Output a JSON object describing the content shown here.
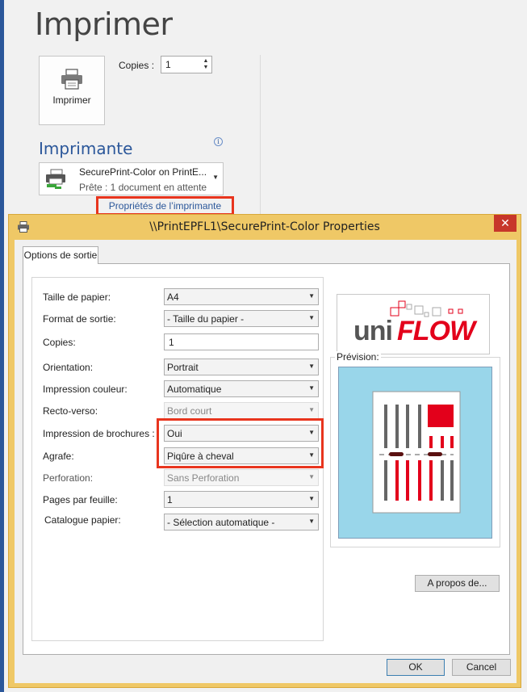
{
  "backstage": {
    "title": "Imprimer",
    "print_button_label": "Imprimer",
    "copies_label": "Copies :",
    "copies_value": "1",
    "printer_heading": "Imprimante",
    "info_icon": "i",
    "printer_name": "SecurePrint-Color on PrintE...",
    "printer_status": "Prête : 1 document en attente",
    "properties_link": "Propriétés de l’imprimante"
  },
  "dialog": {
    "title": "\\\\PrintEPFL1\\SecurePrint-Color Properties",
    "close_glyph": "✕",
    "tab_label": "Options de sortie",
    "fields": [
      {
        "label": "Taille de papier:",
        "value": "A4",
        "type": "combo",
        "enabled": true
      },
      {
        "label": "Format de sortie:",
        "value": "- Taille du papier -",
        "type": "combo",
        "enabled": true
      },
      {
        "label": "Copies:",
        "value": "1",
        "type": "text",
        "enabled": true
      },
      {
        "label": "Orientation:",
        "value": "Portrait",
        "type": "combo",
        "enabled": true
      },
      {
        "label": "Impression couleur:",
        "value": "Automatique",
        "type": "combo",
        "enabled": true
      },
      {
        "label": "Recto-verso:",
        "value": "Bord court",
        "type": "combo",
        "enabled": false
      },
      {
        "label": "Impression de brochures :",
        "value": "Oui",
        "type": "combo",
        "enabled": true
      },
      {
        "label": "Agrafe:",
        "value": "Piqûre à cheval",
        "type": "combo",
        "enabled": true
      },
      {
        "label": "Perforation:",
        "value": "Sans Perforation",
        "type": "combo",
        "enabled": false
      },
      {
        "label": "Pages par feuille:",
        "value": "1",
        "type": "combo",
        "enabled": true
      },
      {
        "label": "Catalogue papier:",
        "value": "- Sélection automatique -",
        "type": "combo",
        "enabled": true
      }
    ],
    "logo": {
      "text_uni": "uni",
      "text_flow": "FLOW",
      "colors": {
        "uni": "#555555",
        "flow": "#e3001b"
      }
    },
    "preview_label": "Prévision:",
    "about_button": "A propos de...",
    "ok_button": "OK",
    "cancel_button": "Cancel"
  },
  "colors": {
    "accent": "#2b579a",
    "highlight": "#e8351e",
    "dialog_frame": "#efc866",
    "preview_bg": "#99d6ea",
    "close": "#c7362a"
  },
  "icons": [
    "printer-icon",
    "info-icon",
    "chevron-down-icon",
    "close-icon"
  ]
}
